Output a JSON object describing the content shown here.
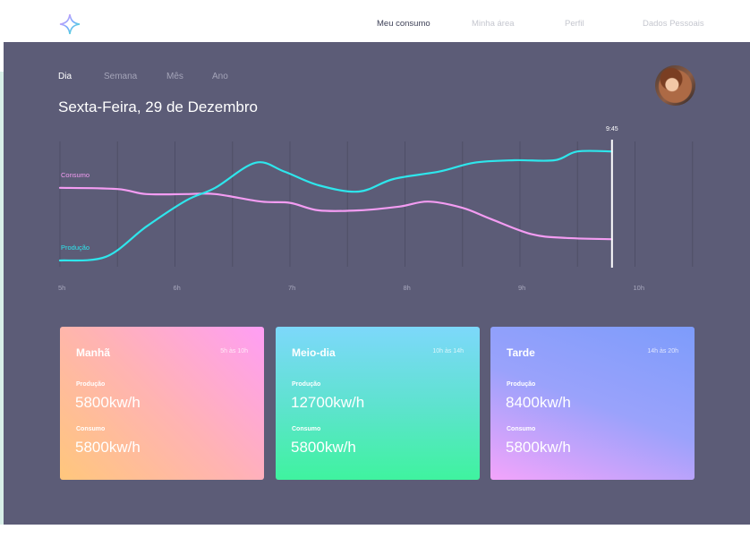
{
  "nav": {
    "logo_icon": "sparkle-logo-icon",
    "items": [
      {
        "label": "Meu consumo",
        "active": true
      },
      {
        "label": "Minha área",
        "active": false
      },
      {
        "label": "Perfil",
        "active": false
      },
      {
        "label": "Dados Pessoais",
        "active": false
      }
    ]
  },
  "period_tabs": [
    {
      "label": "Dia",
      "active": true
    },
    {
      "label": "Semana",
      "active": false
    },
    {
      "label": "Mês",
      "active": false
    },
    {
      "label": "Ano",
      "active": false
    }
  ],
  "date_title": "Sexta-Feira, 29 de Dezembro",
  "chart_data": {
    "type": "line",
    "x_ticks": [
      "5h",
      "6h",
      "7h",
      "8h",
      "9h",
      "10h"
    ],
    "xlim": [
      5,
      10.5
    ],
    "current_time_label": "9:45",
    "current_time": 9.8,
    "series": [
      {
        "name": "Consumo",
        "color": "#f39cf2",
        "points": [
          [
            5.0,
            0.63
          ],
          [
            5.5,
            0.62
          ],
          [
            5.75,
            0.58
          ],
          [
            6.1,
            0.58
          ],
          [
            6.35,
            0.58
          ],
          [
            6.75,
            0.52
          ],
          [
            7.0,
            0.51
          ],
          [
            7.25,
            0.45
          ],
          [
            7.6,
            0.45
          ],
          [
            7.95,
            0.48
          ],
          [
            8.2,
            0.52
          ],
          [
            8.5,
            0.47
          ],
          [
            8.75,
            0.38
          ],
          [
            9.1,
            0.26
          ],
          [
            9.4,
            0.23
          ],
          [
            9.8,
            0.22
          ]
        ]
      },
      {
        "name": "Produção",
        "color": "#2ee6ec",
        "points": [
          [
            5.0,
            0.05
          ],
          [
            5.4,
            0.08
          ],
          [
            5.75,
            0.32
          ],
          [
            6.1,
            0.53
          ],
          [
            6.35,
            0.63
          ],
          [
            6.7,
            0.83
          ],
          [
            6.95,
            0.76
          ],
          [
            7.25,
            0.65
          ],
          [
            7.6,
            0.6
          ],
          [
            7.9,
            0.7
          ],
          [
            8.3,
            0.76
          ],
          [
            8.6,
            0.83
          ],
          [
            8.95,
            0.85
          ],
          [
            9.3,
            0.85
          ],
          [
            9.5,
            0.92
          ],
          [
            9.8,
            0.92
          ]
        ]
      }
    ]
  },
  "cards": [
    {
      "title": "Manhã",
      "hours": "5h às 10h",
      "production_label": "Produção",
      "production_value": "5800kw/h",
      "consumption_label": "Consumo",
      "consumption_value": "5800kw/h"
    },
    {
      "title": "Meio-dia",
      "hours": "10h às 14h",
      "production_label": "Produção",
      "production_value": "12700kw/h",
      "consumption_label": "Consumo",
      "consumption_value": "5800kw/h"
    },
    {
      "title": "Tarde",
      "hours": "14h às 20h",
      "production_label": "Produção",
      "production_value": "8400kw/h",
      "consumption_label": "Consumo",
      "consumption_value": "5800kw/h"
    }
  ]
}
